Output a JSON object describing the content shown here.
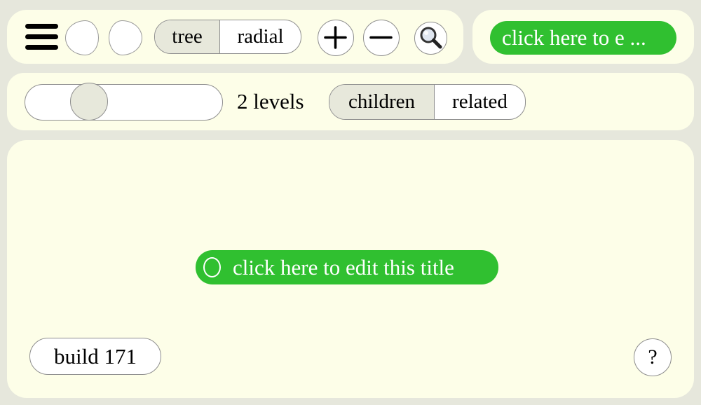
{
  "toolbar": {
    "menu_icon": "hamburger-icon",
    "back_icon": "back-icon",
    "forward_icon": "forward-icon",
    "layout_options": [
      "tree",
      "radial"
    ],
    "layout_selected": "tree",
    "zoom_in_icon": "plus-icon",
    "zoom_out_icon": "minus-icon",
    "search_icon": "magnifier-icon"
  },
  "title_panel": {
    "title": "click here to e ..."
  },
  "controls": {
    "depth_level": 2,
    "levels_label": "2 levels",
    "relation_options": [
      "children",
      "related"
    ],
    "relation_selected": "children"
  },
  "canvas": {
    "node_title": "click here to edit this title",
    "build_label": "build 171",
    "help_label": "?"
  },
  "colors": {
    "background": "#e6e7dc",
    "panel": "#fdfee8",
    "accent_green": "#30c030",
    "selected": "#e7e8db",
    "border": "#8e8e8e"
  }
}
